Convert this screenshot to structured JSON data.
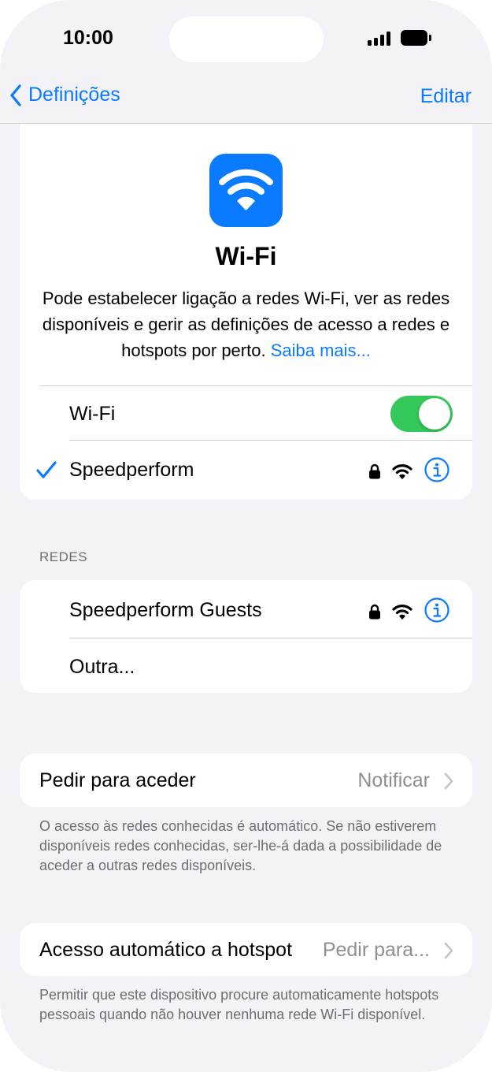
{
  "status_bar": {
    "time": "10:00"
  },
  "nav": {
    "back_label": "Definições",
    "edit_label": "Editar"
  },
  "header": {
    "title": "Wi-Fi",
    "description": "Pode estabelecer ligação a redes Wi-Fi, ver as redes disponíveis e gerir as definições de acesso a redes e hotspots por perto.",
    "learn_more": "Saiba mais..."
  },
  "wifi_toggle": {
    "label": "Wi-Fi",
    "enabled": true
  },
  "connected_network": {
    "name": "Speedperform"
  },
  "networks": {
    "section_title": "REDES",
    "items": [
      {
        "name": "Speedperform Guests"
      }
    ],
    "other_label": "Outra..."
  },
  "ask_to_join": {
    "label": "Pedir para aceder",
    "value": "Notificar",
    "footnote": "O acesso às redes conhecidas é automático. Se não estiverem disponíveis redes conhecidas, ser-lhe-á dada a possibilidade de aceder a outras redes disponíveis."
  },
  "auto_hotspot": {
    "label": "Acesso automático a hotspot",
    "value": "Pedir para...",
    "footnote": "Permitir que este dispositivo procure automaticamente hotspots pessoais quando não houver nenhuma rede Wi-Fi disponível."
  },
  "colors": {
    "accent": "#0a7aff",
    "toggle_on": "#34c759",
    "background": "#f2f2f7"
  }
}
